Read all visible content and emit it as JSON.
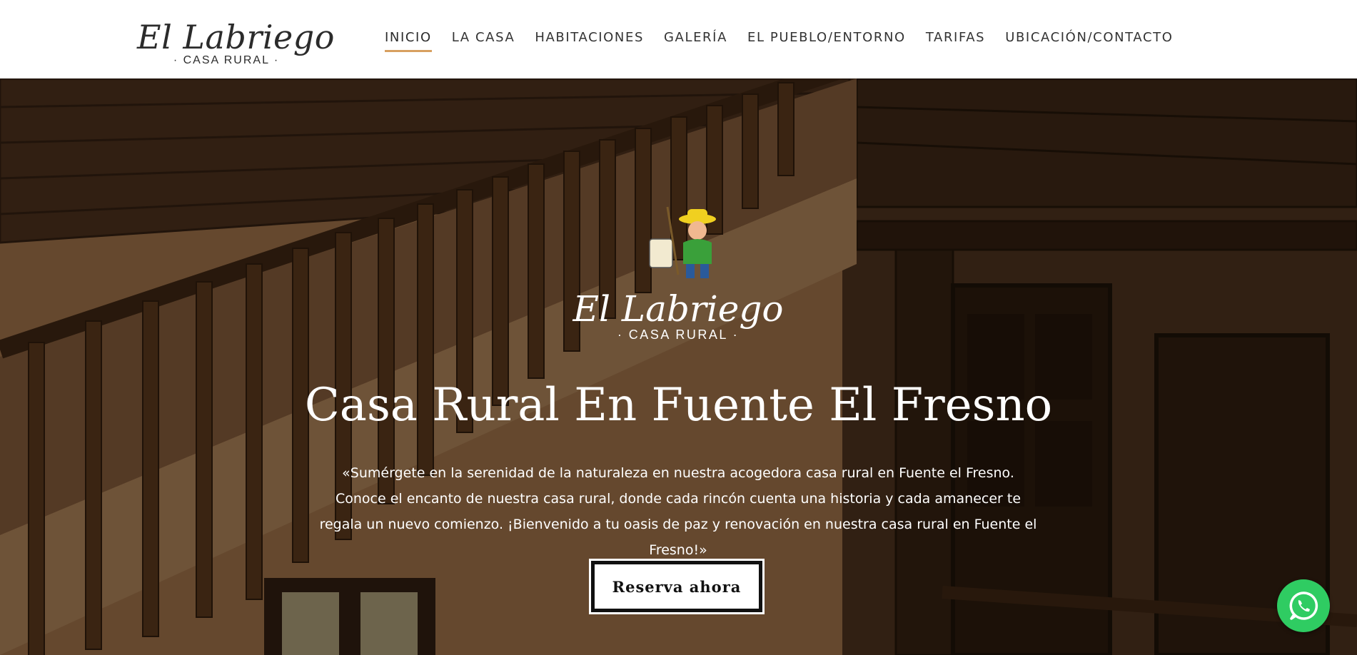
{
  "header": {
    "logo": {
      "name": "El Labriego",
      "subtitle": "· CASA RURAL ·"
    },
    "nav": [
      {
        "label": "INICIO",
        "active": true
      },
      {
        "label": "LA CASA",
        "active": false
      },
      {
        "label": "HABITACIONES",
        "active": false
      },
      {
        "label": "GALERÍA",
        "active": false
      },
      {
        "label": "EL PUEBLO/ENTORNO",
        "active": false
      },
      {
        "label": "TARIFAS",
        "active": false
      },
      {
        "label": "UBICACIÓN/CONTACTO",
        "active": false
      }
    ]
  },
  "hero": {
    "logo": {
      "name": "El Labriego",
      "subtitle": "· CASA RURAL ·"
    },
    "title": "Casa Rural En Fuente El Fresno",
    "description": "«Sumérgete en la serenidad de la naturaleza en nuestra acogedora casa rural en Fuente el Fresno. Conoce el encanto de nuestra casa rural, donde cada rincón cuenta una historia y cada amanecer te regala un nuevo comienzo. ¡Bienvenido a tu oasis de paz y renovación en nuestra casa rural en Fuente el Fresno!»",
    "cta_label": "Reserva ahora"
  },
  "floating": {
    "icon": "whatsapp-icon"
  },
  "colors": {
    "accent_underline": "#d8a060",
    "whatsapp_green": "#2fcc62",
    "wood_dark": "#3a2616",
    "wood_light": "#8a6340"
  }
}
